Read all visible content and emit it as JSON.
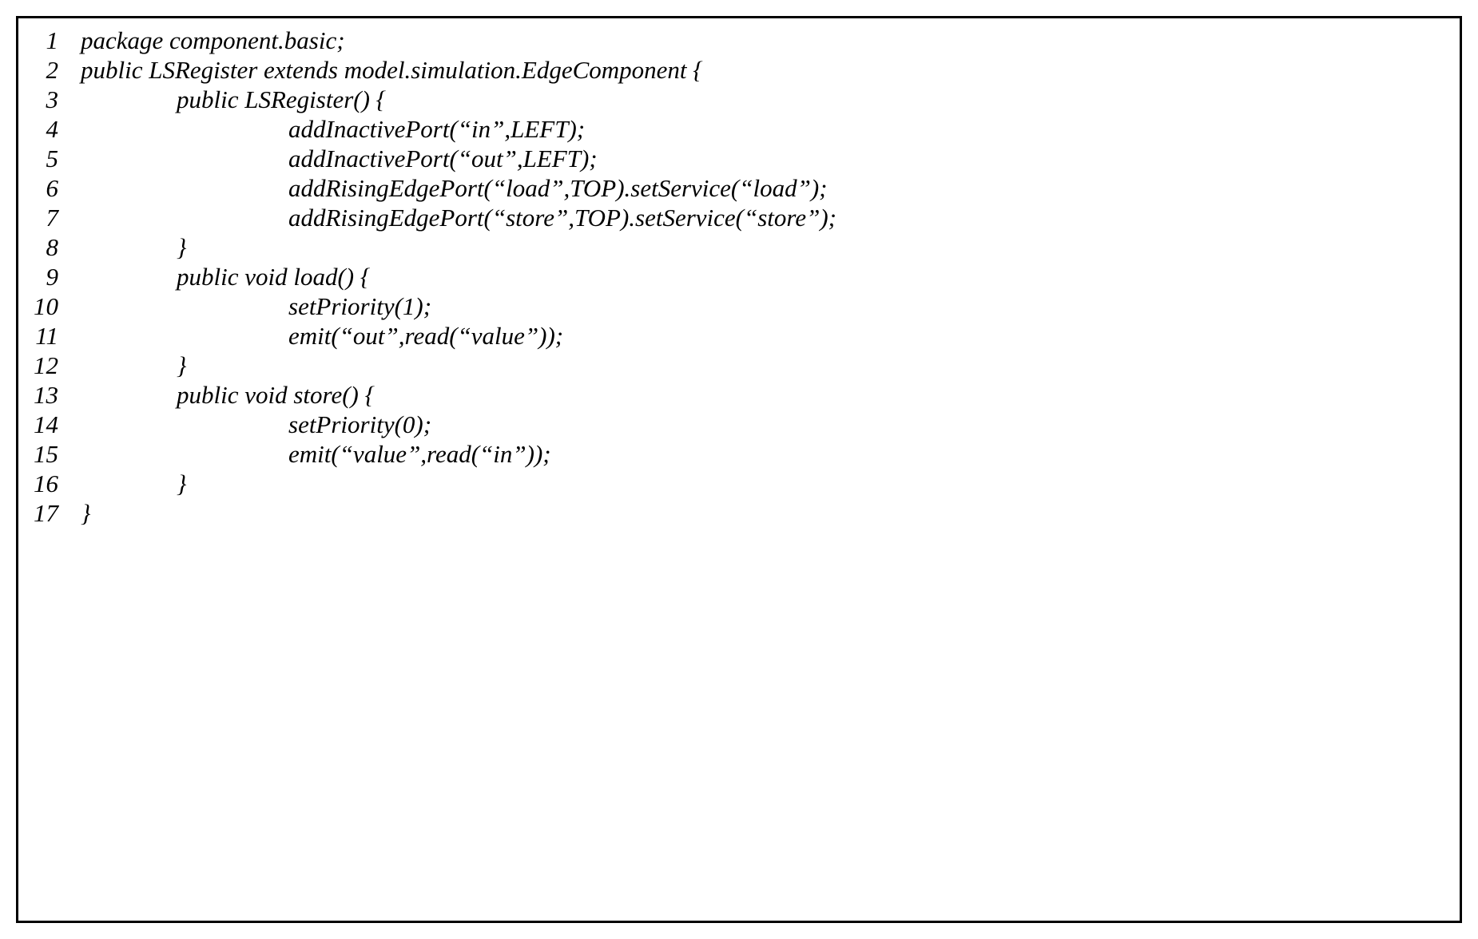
{
  "code": {
    "lines": [
      {
        "num": "1",
        "indent": 0,
        "text": "package component.basic;"
      },
      {
        "num": "2",
        "indent": 0,
        "text": "public LSRegister extends model.simulation.EdgeComponent {"
      },
      {
        "num": "3",
        "indent": 1,
        "text": "public LSRegister() {"
      },
      {
        "num": "4",
        "indent": 2,
        "text": "addInactivePort(“in”,LEFT);"
      },
      {
        "num": "5",
        "indent": 2,
        "text": "addInactivePort(“out”,LEFT);"
      },
      {
        "num": "6",
        "indent": 2,
        "text": "addRisingEdgePort(“load”,TOP).setService(“load”);"
      },
      {
        "num": "7",
        "indent": 2,
        "text": "addRisingEdgePort(“store”,TOP).setService(“store”);"
      },
      {
        "num": "8",
        "indent": 1,
        "text": "}"
      },
      {
        "num": "9",
        "indent": 1,
        "text": "public void load() {"
      },
      {
        "num": "10",
        "indent": 2,
        "text": "setPriority(1);"
      },
      {
        "num": "11",
        "indent": 2,
        "text": "emit(“out”,read(“value”));"
      },
      {
        "num": "12",
        "indent": 1,
        "text": "}"
      },
      {
        "num": "13",
        "indent": 1,
        "text": "public void store() {"
      },
      {
        "num": "14",
        "indent": 2,
        "text": "setPriority(0);"
      },
      {
        "num": "15",
        "indent": 2,
        "text": "emit(“value”,read(“in”));"
      },
      {
        "num": "16",
        "indent": 1,
        "text": "}"
      },
      {
        "num": "17",
        "indent": 0,
        "text": "}"
      }
    ]
  }
}
